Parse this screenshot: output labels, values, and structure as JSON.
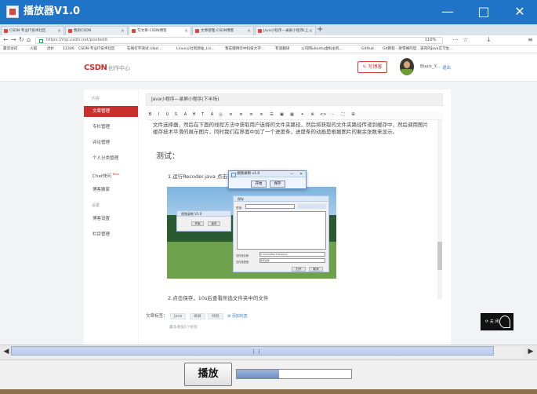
{
  "window": {
    "title": "播放器V1.0",
    "minimize": "—",
    "maximize": "□",
    "close": "✕"
  },
  "browser": {
    "tabs": [
      {
        "label": "CSDN-专业IT技术社区"
      },
      {
        "label": "我的CSDN"
      },
      {
        "label": "写文章-CSDN博客"
      },
      {
        "label": "文章管理-CSDN博客"
      },
      {
        "label": "Java小程序—录屏小程序(上..."
      }
    ],
    "new_tab": "+",
    "nav": {
      "back": "←",
      "forward": "→",
      "reload": "↻",
      "home": "⌂"
    },
    "address": "https://mp.csdn.net/postedit",
    "zoom": "110%",
    "bookmarks": [
      "最常访问",
      "火狐",
      "虎扑",
      "12306",
      "CSDN-专业IT技术社区",
      "在线打字测试 (dazi...",
      "Linux公社资源站_Lin...",
      "我在膜拜华中科技大学...",
      "有道翻译",
      "公司网ubuntu虚拟主机...",
      "GitHub",
      "Git教程 - 廖雪峰的官...",
      "道同的Java实习生..."
    ]
  },
  "csdn": {
    "logo": "CSDN",
    "logo_sub": "创作中心",
    "write_button": "写博客",
    "username": "Black_Y...",
    "logout": "退出"
  },
  "sidebar": {
    "section_content": "内容",
    "items": [
      {
        "label": "文章管理",
        "new": ""
      },
      {
        "label": "专栏管理",
        "new": ""
      },
      {
        "label": "评论管理",
        "new": ""
      },
      {
        "label": "个人分类管理",
        "new": ""
      },
      {
        "label": "Chat快问",
        "new": "New"
      },
      {
        "label": "博客搬家",
        "new": ""
      }
    ],
    "section_settings": "设置",
    "settings_items": [
      {
        "label": "博客设置"
      },
      {
        "label": "栏目管理"
      }
    ]
  },
  "editor": {
    "title": "Java小程序—录屏小程序(下半场)",
    "toolbar_icons": [
      "bold-icon",
      "italic-icon",
      "underline-icon",
      "strikethrough-icon",
      "heading-icon",
      "superscript-icon",
      "subscript-icon",
      "font-icon",
      "clear-format-icon",
      "align-left-icon",
      "align-center-icon",
      "align-right-icon",
      "list-icon",
      "quote-icon",
      "image-icon",
      "table-icon",
      "link-icon",
      "attachment-icon",
      "code-icon",
      "more-icon",
      "fullscreen-icon",
      "source-icon"
    ],
    "toolbar_glyphs": [
      "B",
      "I",
      "U",
      "S",
      "A",
      "H",
      "T",
      "A",
      "Ⓐ",
      "≡",
      "≡",
      "≡",
      "≡",
      "☰",
      "▣",
      "▦",
      "⚭",
      "⊕",
      "<>",
      "⋯",
      "⛶",
      "⊞"
    ],
    "paragraph": "文件选择器，然后在下面的线程方法中获取用户选择的文件夹路径，然后将获取的文件夹路径传递到缓存中，然后调用图片缓存技术平滑的展示图片，同时我们在界面中加了一个进度条，进度条的动画是根据图片的剩余张数来显示。",
    "test_title": "测试：",
    "step1": "1.运行Recoder.java 点击开始，选择一个文件夹",
    "step2": "2.点击保存，10s后查看所选文件夹中的文件",
    "tags_label": "文章标签：",
    "tags": [
      "Java",
      "录屏",
      "线程"
    ],
    "add_tag": "添加标签",
    "tags_hint": "最多添加5个标签"
  },
  "inner_shot": {
    "small_window_title": "视频录制 V1.0",
    "small_button_1": "开始",
    "small_button_2": "保存",
    "file_dialog_title": "保存",
    "file_label_find": "查找：",
    "file_name_label": "文件夹名称：",
    "file_type_label": "文件夹类型：",
    "file_name_value": "C:\\Users\\Black\\Desktop",
    "file_type_value": "所有文件",
    "open_button": "打开",
    "cancel_button": "取消"
  },
  "floating_dialog": {
    "title": "视频录制 v1.0",
    "minimize": "—",
    "close": "✕",
    "button_1": "开始",
    "button_2": "保存"
  },
  "floating_widget": {
    "label": "⟳ 关 闭"
  },
  "player": {
    "left_arrow": "◀",
    "right_arrow": "▶",
    "play_button": "播放",
    "progress": 0.37
  }
}
